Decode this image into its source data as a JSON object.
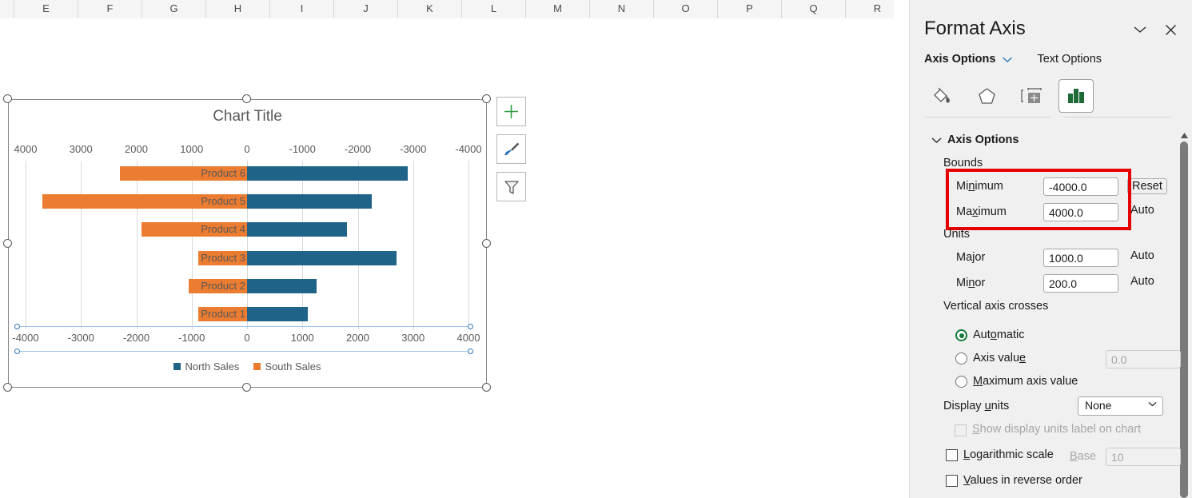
{
  "spreadsheet": {
    "columns": [
      "E",
      "F",
      "G",
      "H",
      "I",
      "J",
      "K",
      "L",
      "M",
      "N",
      "O",
      "P",
      "Q",
      "R"
    ]
  },
  "chart_side_buttons": [
    {
      "name": "chart-elements-button",
      "icon": "plus-icon",
      "label": "+"
    },
    {
      "name": "chart-styles-button",
      "icon": "paintbrush-icon",
      "label": ""
    },
    {
      "name": "chart-filters-button",
      "icon": "funnel-icon",
      "label": ""
    }
  ],
  "chart_data": {
    "type": "bar",
    "title": "Chart Title",
    "orientation": "horizontal",
    "stacked": false,
    "categories": [
      "Product 1",
      "Product 2",
      "Product 3",
      "Product 4",
      "Product 5",
      "Product 6"
    ],
    "series": [
      {
        "name": "North Sales",
        "color": "#1f6389",
        "values": [
          1100,
          1250,
          2700,
          1800,
          2250,
          2900
        ]
      },
      {
        "name": "South Sales",
        "color": "#ec7c30",
        "values": [
          -880,
          -1050,
          -880,
          -1900,
          -3700,
          -2300
        ]
      }
    ],
    "xlabel": "",
    "ylabel": "",
    "xlim": [
      -4000,
      4000
    ],
    "major_unit": 1000,
    "minor_unit": 200,
    "grid": true,
    "legend_position": "bottom",
    "legend": [
      "North Sales",
      "South Sales"
    ],
    "secondary_axis_top": {
      "reversed": true,
      "tick_labels": [
        "4000",
        "3000",
        "2000",
        "1000",
        "0",
        "-1000",
        "-2000",
        "-3000",
        "-4000"
      ]
    },
    "primary_axis_bottom": {
      "reversed": false,
      "selected": true,
      "tick_labels": [
        "-4000",
        "-3000",
        "-2000",
        "-1000",
        "0",
        "1000",
        "2000",
        "3000",
        "4000"
      ]
    }
  },
  "task_pane": {
    "title": "Format Axis",
    "collapse_icon": "chevron-down-icon",
    "close_icon": "close-icon",
    "tabs": [
      {
        "label": "Axis Options",
        "active": true,
        "caret": "chevron-down-icon"
      },
      {
        "label": "Text Options",
        "active": false
      }
    ],
    "icon_tabs": [
      {
        "name": "fill-line-icon",
        "active": false
      },
      {
        "name": "effects-icon",
        "active": false
      },
      {
        "name": "size-properties-icon",
        "active": false
      },
      {
        "name": "axis-options-chart-icon",
        "active": true
      }
    ],
    "section": {
      "label": "Axis Options",
      "expand_icon": "chevron-down-icon"
    },
    "bounds": {
      "group_label": "Bounds",
      "highlighted": true,
      "highlight_color": "#e60000",
      "minimum": {
        "label": "Minimum",
        "value": "-4000.0",
        "side_button": "Reset"
      },
      "maximum": {
        "label": "Maximum",
        "value": "4000.0",
        "side_button": "Auto"
      }
    },
    "units": {
      "group_label": "Units",
      "major": {
        "label": "Major",
        "value": "1000.0",
        "side_button": "Auto"
      },
      "minor": {
        "label": "Minor",
        "value": "200.0",
        "side_button": "Auto"
      }
    },
    "vertical_axis_crosses": {
      "group_label": "Vertical axis crosses",
      "options": [
        {
          "label": "Automatic",
          "selected": true
        },
        {
          "label": "Axis value",
          "selected": false,
          "value": "0.0",
          "disabled": true
        },
        {
          "label": "Maximum axis value",
          "selected": false
        }
      ]
    },
    "display_units": {
      "label": "Display units",
      "value": "None",
      "caret": "chevron-down-icon"
    },
    "show_display_units_label": {
      "label": "Show display units label on chart",
      "checked": false,
      "disabled": true
    },
    "logarithmic_scale": {
      "label": "Logarithmic scale",
      "checked": false,
      "base_label": "Base",
      "base_value": "10",
      "base_disabled": true
    },
    "values_in_reverse_order": {
      "label": "Values in reverse order",
      "checked": false
    }
  }
}
